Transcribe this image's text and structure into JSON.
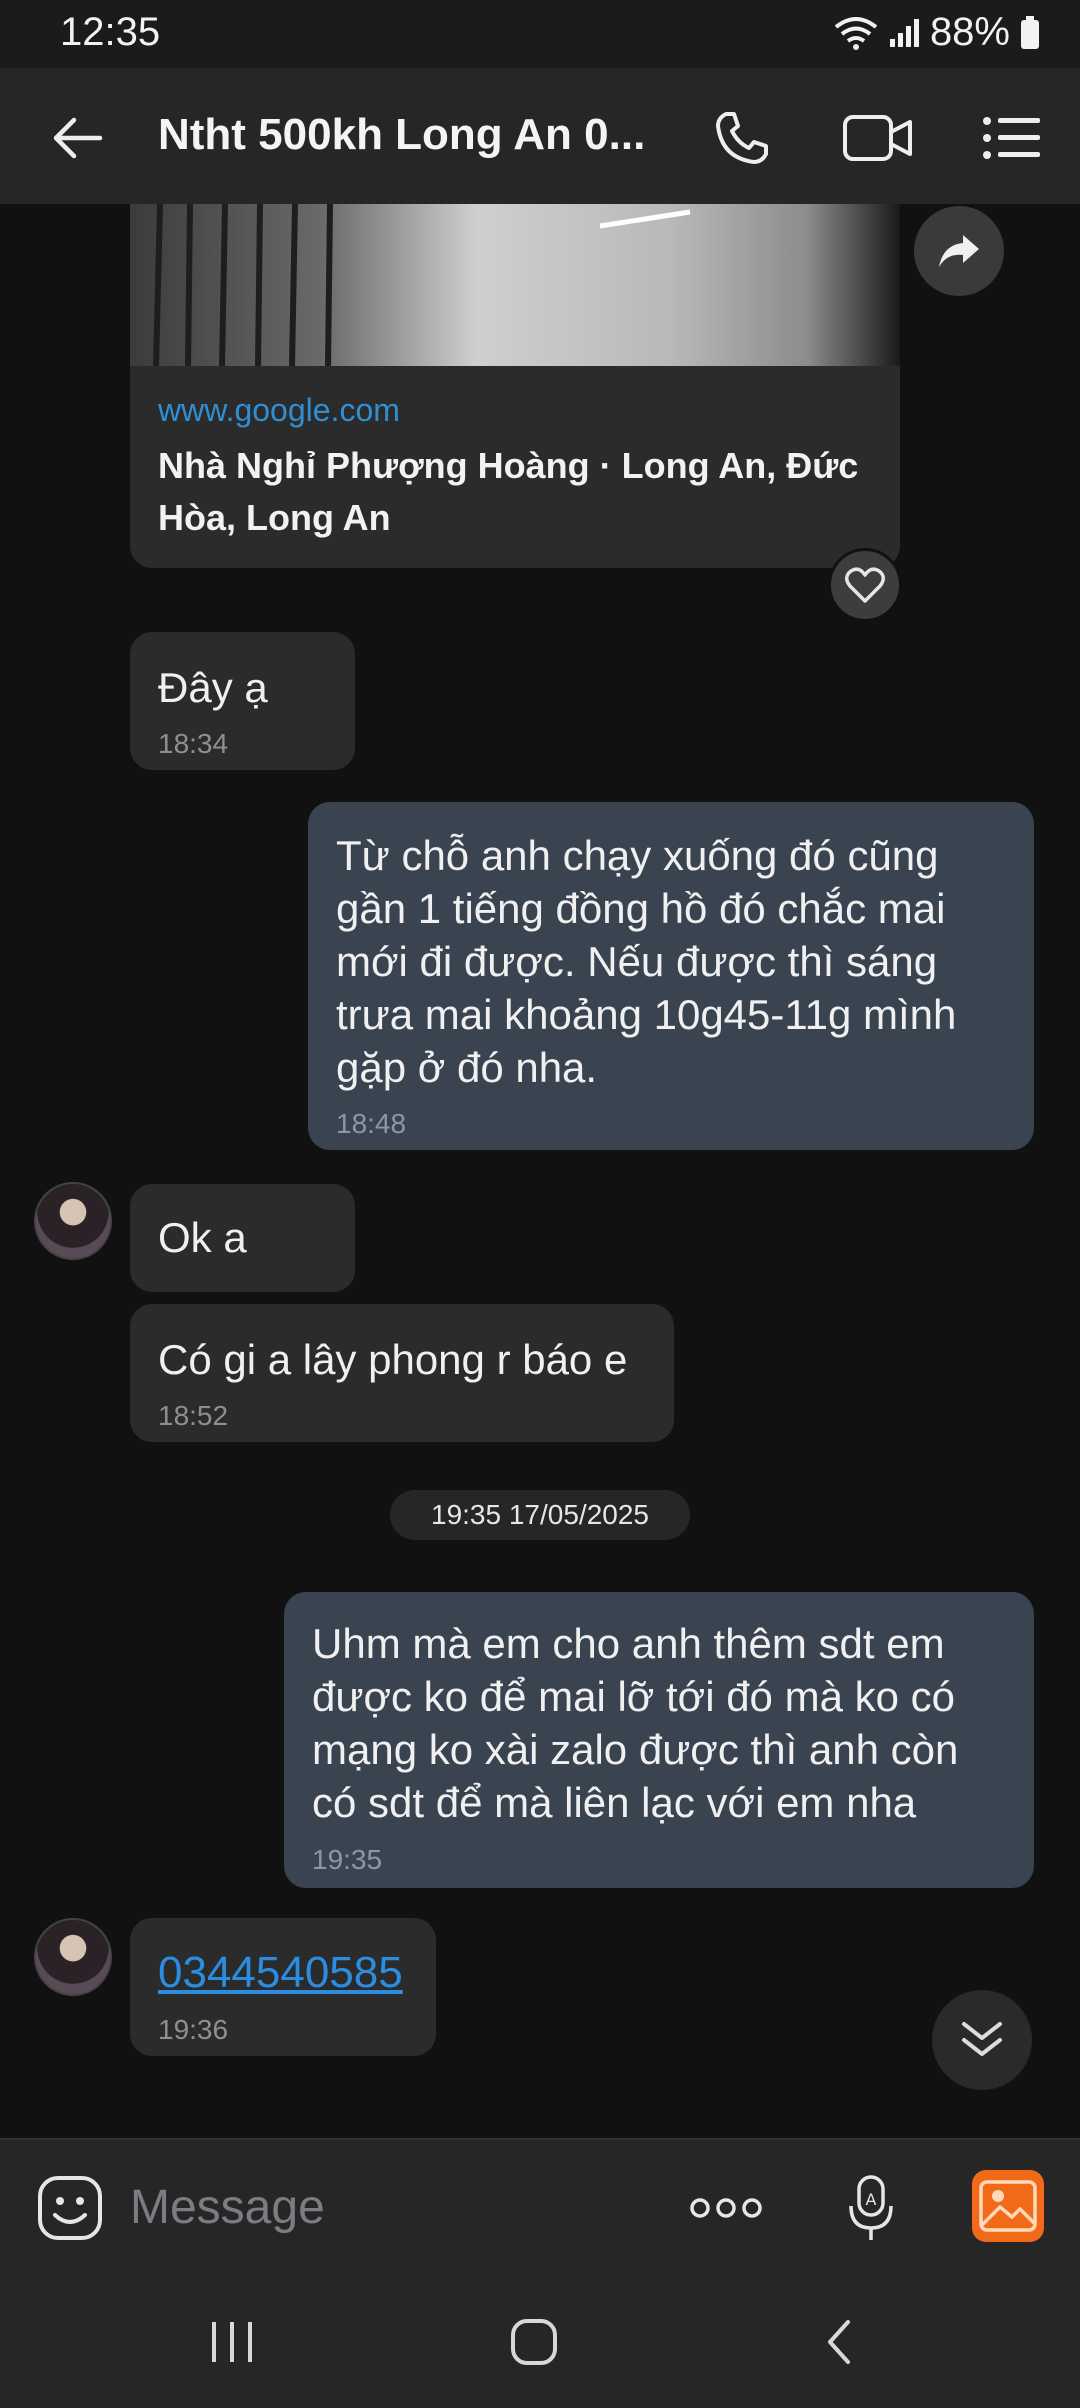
{
  "status_bar": {
    "time": "12:35",
    "battery": "88%",
    "icons": [
      "wifi-icon",
      "signal-icon",
      "battery-icon"
    ]
  },
  "header": {
    "title": "Ntht 500kh Long An 0...",
    "icons": [
      "back-arrow-icon",
      "phone-icon",
      "video-call-icon",
      "menu-list-icon"
    ]
  },
  "link_preview": {
    "url": "www.google.com",
    "title": "Nhà Nghỉ Phượng Hoàng · Long An, Đức Hòa, Long An"
  },
  "messages": [
    {
      "side": "in",
      "text": "Đây ạ",
      "time": "18:34"
    },
    {
      "side": "out",
      "lines": [
        "Từ chỗ anh chạy xuống đó cũng",
        "gần 1 tiếng đồng hồ đó chắc mai",
        "mới đi được. Nếu được thì sáng",
        "trưa mai khoảng 10g45-11g mình",
        "gặp ở đó nha."
      ],
      "time": "18:48"
    },
    {
      "side": "in",
      "text": "Ok a"
    },
    {
      "side": "in",
      "text": "Có gi a lây phong r báo e",
      "time": "18:52"
    },
    {
      "side": "out",
      "lines": [
        "Uhm mà em cho anh thêm sdt em",
        "được ko để mai lỡ tới đó mà ko có",
        "mạng ko xài zalo được thì anh còn",
        "có sdt để mà liên lạc với em nha"
      ],
      "time": "19:35"
    },
    {
      "side": "in",
      "text": "0344540585",
      "time": "19:36"
    }
  ],
  "date_separator": "19:35 17/05/2025",
  "composer": {
    "placeholder": "Message",
    "icons": [
      "sticker-icon",
      "more-dots-icon",
      "voice-input-icon",
      "gallery-icon"
    ]
  },
  "colors": {
    "background": "#111112",
    "incoming_bubble": "#2b2b2c",
    "outgoing_bubble": "#3a4451",
    "link": "#2f8fd1",
    "gallery_accent": "#f06a1a"
  }
}
